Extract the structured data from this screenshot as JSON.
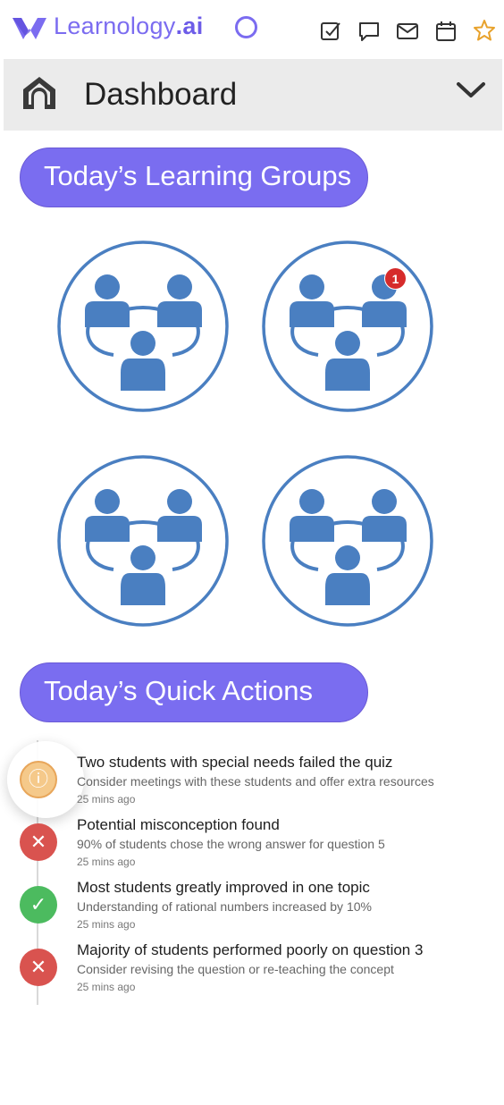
{
  "app": {
    "brand_name": "Learnology",
    "brand_suffix": ".ai"
  },
  "toolbar": {
    "icons": [
      "checkbox-icon",
      "chat-icon",
      "mail-icon",
      "calendar-icon",
      "star-icon"
    ]
  },
  "header": {
    "title": "Dashboard"
  },
  "learning_groups": {
    "heading": "Today’s Learning Groups",
    "groups": [
      {
        "badge": ""
      },
      {
        "badge": "1"
      },
      {
        "badge": ""
      },
      {
        "badge": ""
      }
    ]
  },
  "quick_actions": {
    "heading": "Today’s Quick Actions",
    "items": [
      {
        "status": "info",
        "title": "Two students with special needs failed the quiz",
        "description": "Consider meetings with these students and offer extra resources",
        "time": "25 mins ago"
      },
      {
        "status": "error",
        "title": "Potential misconception found",
        "description": "90% of students chose the wrong answer for question 5",
        "time": "25 mins ago"
      },
      {
        "status": "success",
        "title": "Most students greatly improved in one topic",
        "description": "Understanding of rational numbers increased by 10%",
        "time": "25 mins ago"
      },
      {
        "status": "error",
        "title": "Majority of students performed poorly on question 3",
        "description": "Consider revising the question or re-teaching the concept",
        "time": "25 mins ago"
      }
    ]
  },
  "colors": {
    "brand": "#7a6df0",
    "group_blue": "#4a7fc1",
    "error": "#d9534f",
    "success": "#4cbb5f",
    "info": "#f5c98a"
  }
}
